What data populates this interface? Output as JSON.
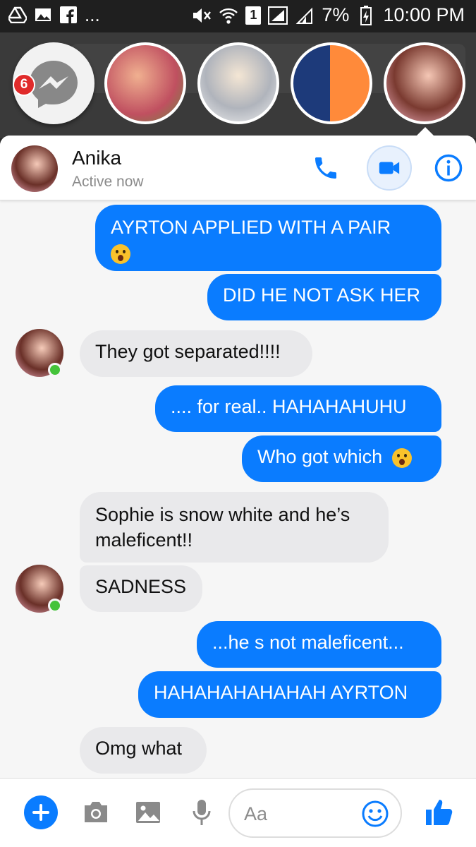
{
  "status_bar": {
    "battery": "7%",
    "time": "10:00 PM",
    "sim_label": "1",
    "left_icons": [
      "drive-icon",
      "gallery-icon",
      "facebook-icon"
    ],
    "overflow": "..."
  },
  "chat_heads": {
    "unread_badge": "6",
    "heads": [
      "messenger-icon",
      "contact-head-1",
      "contact-head-2",
      "contact-head-3",
      "contact-head-anika"
    ]
  },
  "header": {
    "name": "Anika",
    "status": "Active now"
  },
  "messages": [
    {
      "dir": "out",
      "text": "AYRTON APPLIED WITH A PAIR",
      "emoji": "surprised-emoji"
    },
    {
      "dir": "out",
      "text": "DID HE NOT ASK HER"
    },
    {
      "dir": "in",
      "text": "They got separated!!!!"
    },
    {
      "dir": "out",
      "text": ".... for real.. HAHAHAHUHU"
    },
    {
      "dir": "out",
      "text": "Who got which",
      "emoji": "surprised-emoji"
    },
    {
      "dir": "in",
      "text": "Sophie is snow white and he’s",
      "text2": "maleficent!!"
    },
    {
      "dir": "in",
      "text": "SADNESS"
    },
    {
      "dir": "out",
      "text": "...he s not maleficent..."
    },
    {
      "dir": "out",
      "text": "HAHAHAHAHAHAH AYRTON"
    },
    {
      "dir": "in",
      "text": "Omg what"
    }
  ],
  "composer": {
    "placeholder": "Aa"
  },
  "colors": {
    "accent": "#0a7cff",
    "incoming_bubble": "#e9e9eb",
    "online": "#44c33a",
    "badge": "#e02b2b"
  }
}
